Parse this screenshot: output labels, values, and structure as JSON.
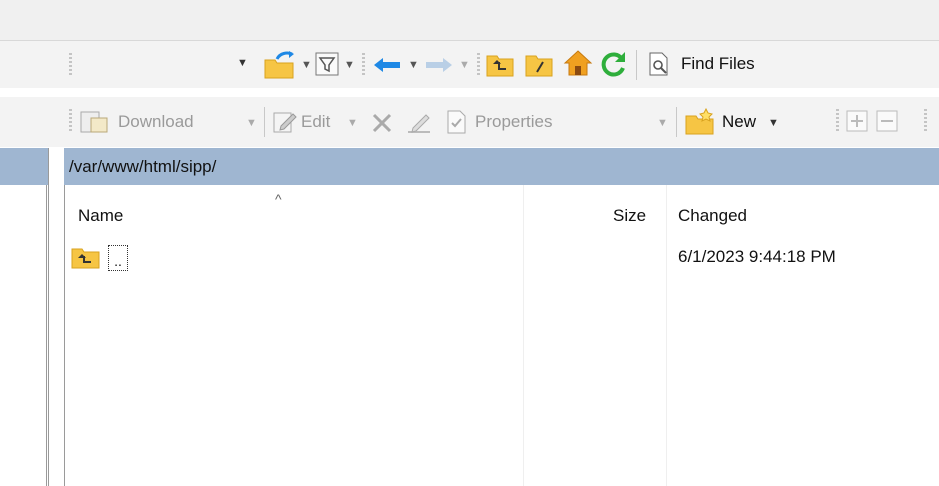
{
  "path_combo": {
    "value": "sipp"
  },
  "toolbar1": {
    "icons": [
      "open-folder-icon",
      "filter-icon",
      "back-arrow-icon",
      "forward-arrow-icon",
      "parent-directory-icon",
      "root-directory-icon",
      "home-icon",
      "refresh-icon",
      "find-files-icon"
    ],
    "find_files_label": "Find Files"
  },
  "toolbar2": {
    "download_label": "Download",
    "edit_label": "Edit",
    "properties_label": "Properties",
    "new_label": "New"
  },
  "current_path": "/var/www/html/sipp/",
  "columns": {
    "name": "Name",
    "size": "Size",
    "changed": "Changed",
    "sort_indicator": "^"
  },
  "rows": [
    {
      "name": "..",
      "size": "",
      "changed": "6/1/2023 9:44:18 PM",
      "icon": "parent-directory-icon"
    }
  ],
  "colors": {
    "path_bar": "#9fb6d1",
    "toolbar_bg": "#f3f3f3",
    "folder": "#f6c544",
    "accent_blue": "#1e88e5",
    "green": "#2eae3b"
  }
}
